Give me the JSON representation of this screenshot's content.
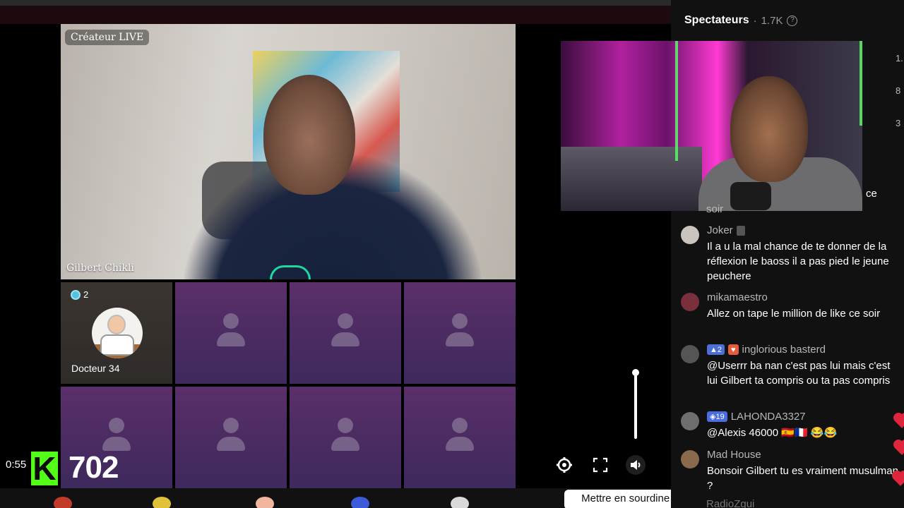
{
  "stream": {
    "host_badge": "Créateur LIVE",
    "host_name": "Gilbert Chikli",
    "guest": {
      "name": "Docteur 34",
      "count": "2"
    },
    "timer": "0:55",
    "viewer_count": "702",
    "tooltip": "Mettre en sourdine (M)",
    "volume_level": 1.0
  },
  "panel": {
    "title": "Spectateurs",
    "separator": "·",
    "viewers": "1.7K",
    "side_numbers": [
      "1.",
      "8",
      "3"
    ],
    "truncated_text_1": "ce",
    "truncated_text_2": "soir"
  },
  "chat": [
    {
      "user": "Joker",
      "badges": [
        "phone"
      ],
      "text": "Il a u la mal chance de te donner de la réflexion le baoss il a pas pied le jeune peuchere",
      "avatar_color": "#c9c4bd"
    },
    {
      "user": "mikamaestro",
      "badges": [],
      "text": "Allez on tape le million de like ce soir",
      "avatar_color": "#7a2f3c"
    },
    {
      "user": "inglorious basterd",
      "badges": [
        "2",
        "heart"
      ],
      "text": "@Userrr ba nan c'est pas lui mais c'est lui Gilbert ta compris ou ta pas compris",
      "avatar_color": "#555555"
    },
    {
      "user": "LAHONDA3327",
      "badges": [
        "19"
      ],
      "text": "@Alexis 46000 🇪🇸🇫🇷 😂😂",
      "avatar_color": "#6e6e6e"
    },
    {
      "user": "Mad House",
      "badges": [],
      "text": "Bonsoir Gilbert tu es vraiment musulman ?",
      "avatar_color": "#8a6a4d"
    }
  ],
  "next_user_partial": "RadioZgui",
  "colors": {
    "kick_green": "#53fc18",
    "panel_bg": "#111111",
    "slot_purple": "#4a2b62"
  },
  "icons": [
    "settings-icon",
    "fullscreen-icon",
    "mute-icon",
    "help-icon"
  ]
}
